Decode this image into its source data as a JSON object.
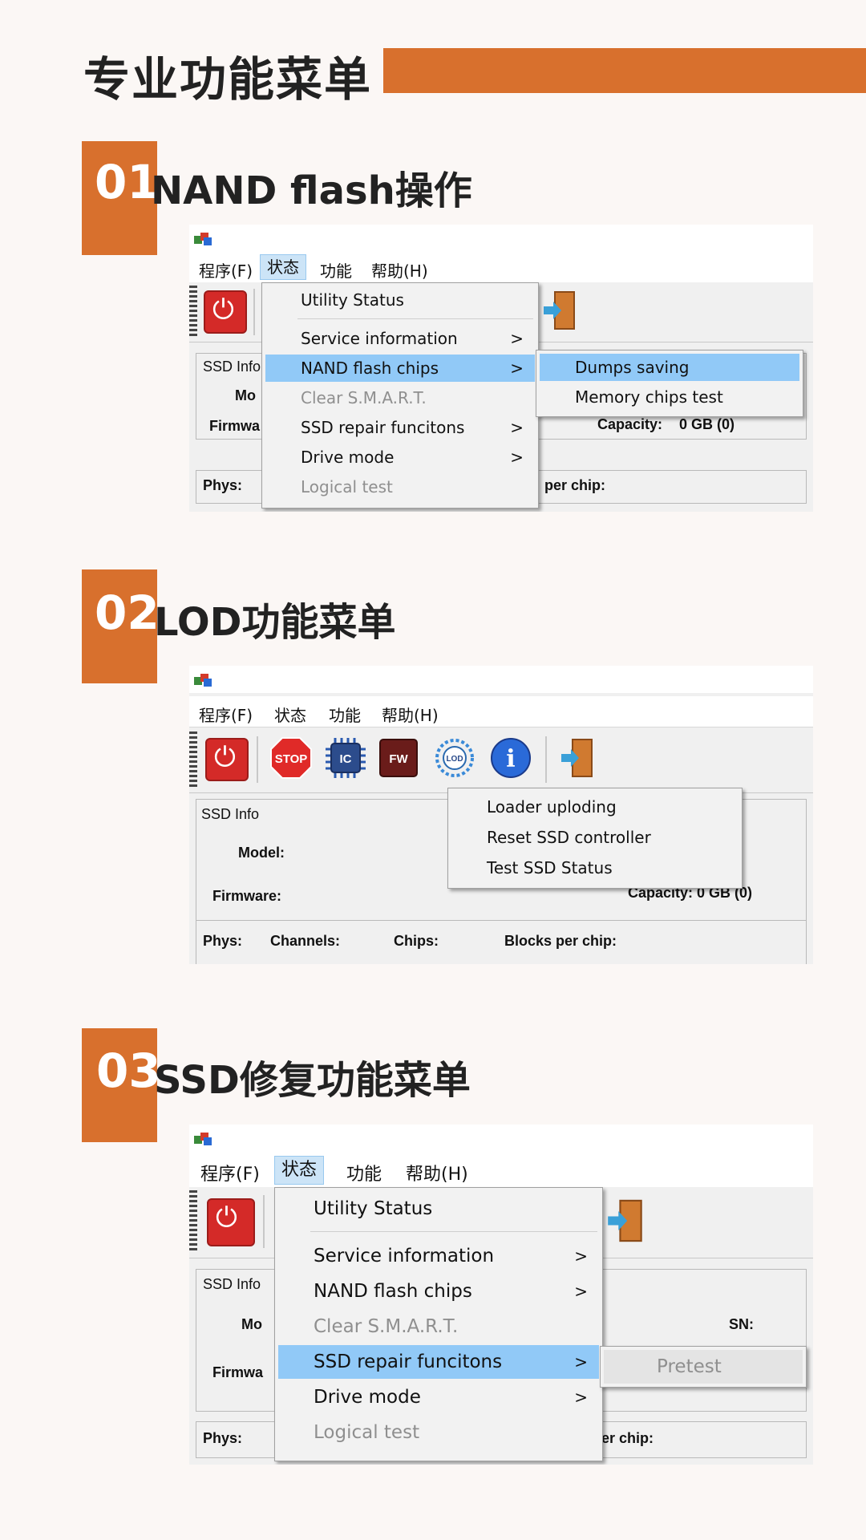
{
  "header": {
    "title": "专业功能菜单"
  },
  "colors": {
    "accent": "#d8702d",
    "highlight": "#91c9f7"
  },
  "sections": [
    {
      "num": "01",
      "title": "NAND flash操作",
      "menubar": [
        "程序(F)",
        "状态",
        "功能",
        "帮助(H)"
      ],
      "info": {
        "group": "SSD Info",
        "model": "Mo",
        "firmware": "Firmwa",
        "capacity_label": "Capacity:",
        "capacity_value": "0 GB (0)",
        "phys": "Phys:",
        "per_chip": "per chip:"
      },
      "menu": [
        "Utility Status",
        "Service information",
        "NAND flash chips",
        "Clear S.M.A.R.T.",
        "SSD repair funcitons",
        "Drive mode",
        "Logical test"
      ],
      "submenu": [
        "Dumps saving",
        "Memory chips test"
      ],
      "arrow": ">"
    },
    {
      "num": "02",
      "title": "LOD功能菜单",
      "menubar": [
        "程序(F)",
        "状态",
        "功能",
        "帮助(H)"
      ],
      "toolbar_labels": {
        "stop": "STOP",
        "ic": "IC",
        "fw": "FW",
        "lod": "LOD",
        "info": "i"
      },
      "info": {
        "group": "SSD Info",
        "model": "Model:",
        "firmware": "Firmware:",
        "capacity_partial": "Capacity:  0 GB (0)",
        "phys": "Phys:",
        "channels": "Channels:",
        "chips": "Chips:",
        "blocks": "Blocks per chip:"
      },
      "menu": [
        "Loader uploding",
        "Reset SSD controller",
        "Test SSD Status"
      ]
    },
    {
      "num": "03",
      "title": "SSD修复功能菜单",
      "menubar": [
        "程序(F)",
        "状态",
        "功能",
        "帮助(H)"
      ],
      "info": {
        "group": "SSD Info",
        "model": "Mo",
        "firmware": "Firmwa",
        "sn": "SN:",
        "phys": "Phys:",
        "per_chip": "per chip:"
      },
      "menu": [
        "Utility Status",
        "Service information",
        "NAND flash chips",
        "Clear S.M.A.R.T.",
        "SSD repair funcitons",
        "Drive mode",
        "Logical test"
      ],
      "submenu": [
        "Pretest"
      ],
      "arrow": ">"
    }
  ]
}
